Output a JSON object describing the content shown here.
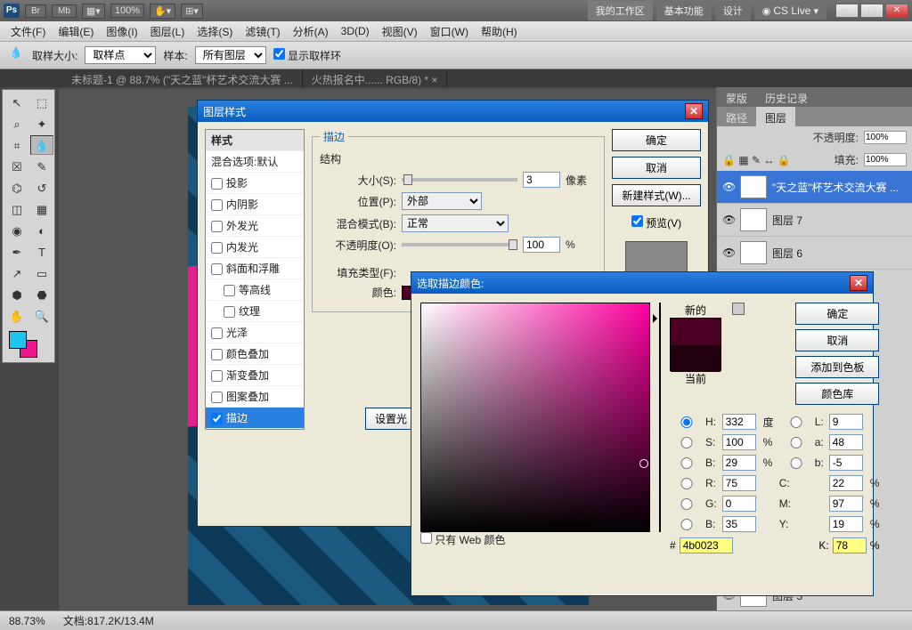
{
  "titlebar": {
    "zoom": "100%",
    "workspace": "我的工作区",
    "basic": "基本功能",
    "design": "设计",
    "cslive": "CS Live"
  },
  "menu": [
    "文件(F)",
    "编辑(E)",
    "图像(I)",
    "图层(L)",
    "选择(S)",
    "滤镜(T)",
    "分析(A)",
    "3D(D)",
    "视图(V)",
    "窗口(W)",
    "帮助(H)"
  ],
  "optbar": {
    "sample_size_lbl": "取样大小:",
    "sample_size_val": "取样点",
    "sample_lbl": "样本:",
    "sample_val": "所有图层",
    "show_ring": "显示取样环"
  },
  "doctabs": [
    "未标题-1 @ 88.7% (\"天之蓝\"杯艺术交流大赛 ...",
    "火热报名中...... RGB/8) * ×"
  ],
  "status": {
    "zoom": "88.73%",
    "doc": "文档:817.2K/13.4M"
  },
  "panel": {
    "toptabs": [
      "蒙版",
      "历史记录"
    ],
    "tabs": [
      "路径",
      "图层"
    ],
    "opacity_lbl": "不透明度:",
    "opacity": "100%",
    "fill_lbl": "填充:",
    "fill": "100%",
    "layers": [
      {
        "name": "\"天之蓝\"杯艺术交流大赛 ...",
        "type": "T",
        "sel": true
      },
      {
        "name": "图层 7",
        "type": "img"
      },
      {
        "name": "图层 6",
        "type": "img"
      },
      {
        "name": "图层 3",
        "type": "img"
      }
    ]
  },
  "layerstyle": {
    "title": "图层样式",
    "styles_hdr": "样式",
    "blend_def": "混合选项:默认",
    "items": [
      "投影",
      "内阴影",
      "外发光",
      "内发光",
      "斜面和浮雕",
      "等高线",
      "纹理",
      "光泽",
      "颜色叠加",
      "渐变叠加",
      "图案叠加",
      "描边"
    ],
    "sel": "描边",
    "section": "描边",
    "struct": "结构",
    "size_lbl": "大小(S):",
    "size": "3",
    "size_unit": "像素",
    "pos_lbl": "位置(P):",
    "pos": "外部",
    "blend_lbl": "混合模式(B):",
    "blend": "正常",
    "opacity_lbl": "不透明度(O):",
    "opacity": "100",
    "pct": "%",
    "filltype_lbl": "填充类型(F):",
    "color_lbl": "颜色:",
    "color": "#4b0023",
    "setdefault": "设置光",
    "btns": {
      "ok": "确定",
      "cancel": "取消",
      "newstyle": "新建样式(W)...",
      "preview": "预览(V)"
    }
  },
  "colorpicker": {
    "title": "选取描边颜色:",
    "new_lbl": "新的",
    "cur_lbl": "当前",
    "btns": {
      "ok": "确定",
      "cancel": "取消",
      "addswatch": "添加到色板",
      "colorlib": "颜色库"
    },
    "H": "332",
    "H_u": "度",
    "S": "100",
    "S_u": "%",
    "B": "29",
    "B_u": "%",
    "L": "9",
    "a": "48",
    "b": "-5",
    "R": "75",
    "G": "0",
    "Bv": "35",
    "C": "22",
    "M": "97",
    "Y": "19",
    "K": "78",
    "hex": "4b0023",
    "webonly": "只有 Web 颜色"
  }
}
